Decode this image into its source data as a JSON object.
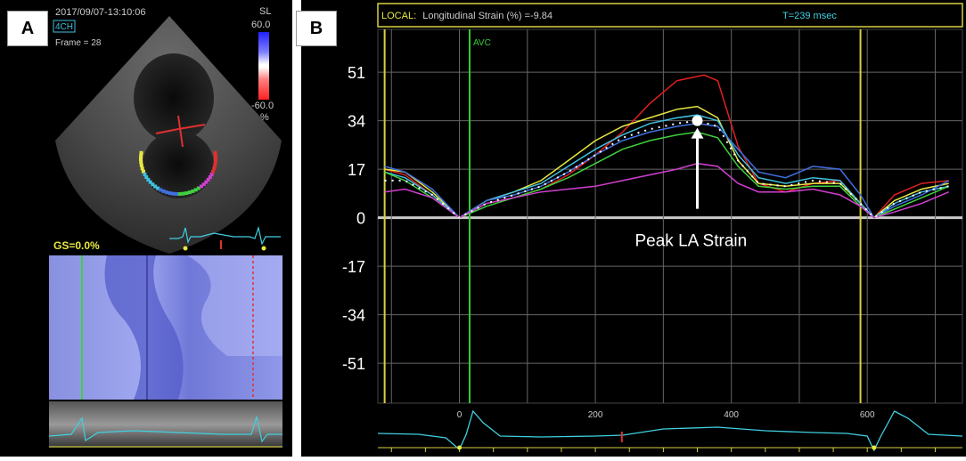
{
  "panel_a": {
    "label": "A",
    "timestamp": "2017/09/07-13:10:06",
    "view": "4CH",
    "frame": "Frame = 28",
    "scale": {
      "title": "SL",
      "max": "60.0",
      "min": "-60.0",
      "unit": "%"
    },
    "gs": "GS=0.0%"
  },
  "panel_b": {
    "label": "B",
    "header_local": "LOCAL:",
    "header_measure": "Longitudinal Strain (%) =-9.84",
    "header_time": "T=239 msec",
    "marker": "AVC",
    "annotation": "Peak LA Strain"
  },
  "colors": {
    "background": "#000000",
    "frame": "#d8d040",
    "grid": "#666666",
    "avc": "#33cc33",
    "ecg": "#40d0e0",
    "annotation": "#ffffff"
  },
  "chart_data": {
    "type": "line",
    "title": "",
    "xlabel": "",
    "ylabel": "",
    "xlim": [
      -120,
      740
    ],
    "ylim": [
      -65,
      66
    ],
    "yticks": [
      51,
      34,
      17,
      0,
      -17,
      -34,
      -51
    ],
    "xticks": [
      0,
      200,
      400,
      600
    ],
    "avc_x": 15,
    "frame_x": [
      -110,
      590
    ],
    "cursor_x": 239,
    "series": [
      {
        "color": "#e02020",
        "dash": false,
        "points": [
          [
            -110,
            17
          ],
          [
            -80,
            15
          ],
          [
            -40,
            8
          ],
          [
            0,
            0
          ],
          [
            40,
            5
          ],
          [
            80,
            7
          ],
          [
            120,
            10
          ],
          [
            160,
            15
          ],
          [
            200,
            22
          ],
          [
            240,
            30
          ],
          [
            280,
            40
          ],
          [
            320,
            48
          ],
          [
            360,
            50
          ],
          [
            380,
            48
          ],
          [
            410,
            25
          ],
          [
            440,
            12
          ],
          [
            480,
            9
          ],
          [
            520,
            12
          ],
          [
            560,
            13
          ],
          [
            590,
            5
          ],
          [
            610,
            0
          ],
          [
            640,
            8
          ],
          [
            680,
            12
          ],
          [
            720,
            13
          ]
        ]
      },
      {
        "color": "#e8e840",
        "dash": false,
        "points": [
          [
            -110,
            17
          ],
          [
            -80,
            16
          ],
          [
            -40,
            9
          ],
          [
            0,
            0
          ],
          [
            40,
            6
          ],
          [
            80,
            9
          ],
          [
            120,
            13
          ],
          [
            160,
            20
          ],
          [
            200,
            27
          ],
          [
            240,
            32
          ],
          [
            280,
            35
          ],
          [
            320,
            38
          ],
          [
            350,
            39
          ],
          [
            380,
            35
          ],
          [
            410,
            20
          ],
          [
            440,
            12
          ],
          [
            480,
            11
          ],
          [
            520,
            12
          ],
          [
            560,
            12
          ],
          [
            590,
            5
          ],
          [
            610,
            0
          ],
          [
            640,
            6
          ],
          [
            680,
            10
          ],
          [
            720,
            12
          ]
        ]
      },
      {
        "color": "#40c0e0",
        "dash": false,
        "points": [
          [
            -110,
            16
          ],
          [
            -80,
            14
          ],
          [
            -40,
            8
          ],
          [
            0,
            0
          ],
          [
            40,
            6
          ],
          [
            80,
            9
          ],
          [
            120,
            12
          ],
          [
            160,
            18
          ],
          [
            200,
            24
          ],
          [
            240,
            29
          ],
          [
            280,
            33
          ],
          [
            320,
            35
          ],
          [
            350,
            36
          ],
          [
            380,
            34
          ],
          [
            410,
            22
          ],
          [
            440,
            14
          ],
          [
            480,
            12
          ],
          [
            520,
            14
          ],
          [
            560,
            13
          ],
          [
            590,
            5
          ],
          [
            610,
            0
          ],
          [
            640,
            5
          ],
          [
            680,
            9
          ],
          [
            720,
            11
          ]
        ]
      },
      {
        "color": "#4070e0",
        "dash": false,
        "points": [
          [
            -110,
            18
          ],
          [
            -80,
            16
          ],
          [
            -40,
            10
          ],
          [
            0,
            0
          ],
          [
            40,
            6
          ],
          [
            80,
            8
          ],
          [
            120,
            11
          ],
          [
            160,
            16
          ],
          [
            200,
            22
          ],
          [
            240,
            27
          ],
          [
            280,
            30
          ],
          [
            320,
            32
          ],
          [
            350,
            33
          ],
          [
            380,
            32
          ],
          [
            410,
            24
          ],
          [
            440,
            16
          ],
          [
            480,
            14
          ],
          [
            520,
            18
          ],
          [
            560,
            17
          ],
          [
            590,
            8
          ],
          [
            610,
            0
          ],
          [
            640,
            4
          ],
          [
            680,
            8
          ],
          [
            720,
            13
          ]
        ]
      },
      {
        "color": "#40d040",
        "dash": false,
        "points": [
          [
            -110,
            16
          ],
          [
            -80,
            13
          ],
          [
            -40,
            7
          ],
          [
            0,
            0
          ],
          [
            40,
            4
          ],
          [
            80,
            7
          ],
          [
            120,
            10
          ],
          [
            160,
            14
          ],
          [
            200,
            19
          ],
          [
            240,
            24
          ],
          [
            280,
            27
          ],
          [
            320,
            29
          ],
          [
            350,
            30
          ],
          [
            380,
            28
          ],
          [
            410,
            18
          ],
          [
            440,
            11
          ],
          [
            480,
            10
          ],
          [
            520,
            11
          ],
          [
            560,
            11
          ],
          [
            590,
            4
          ],
          [
            610,
            0
          ],
          [
            640,
            3
          ],
          [
            680,
            7
          ],
          [
            720,
            11
          ]
        ]
      },
      {
        "color": "#d040d0",
        "dash": false,
        "points": [
          [
            -110,
            9
          ],
          [
            -80,
            10
          ],
          [
            -40,
            7
          ],
          [
            0,
            0
          ],
          [
            40,
            5
          ],
          [
            80,
            7
          ],
          [
            120,
            9
          ],
          [
            160,
            10
          ],
          [
            200,
            11
          ],
          [
            240,
            13
          ],
          [
            280,
            15
          ],
          [
            320,
            17
          ],
          [
            350,
            19
          ],
          [
            380,
            18
          ],
          [
            410,
            12
          ],
          [
            440,
            9
          ],
          [
            480,
            9
          ],
          [
            520,
            10
          ],
          [
            560,
            8
          ],
          [
            590,
            4
          ],
          [
            610,
            0
          ],
          [
            640,
            2
          ],
          [
            680,
            5
          ],
          [
            720,
            9
          ]
        ]
      },
      {
        "color": "#ffffff",
        "dash": true,
        "points": [
          [
            -110,
            13
          ],
          [
            -80,
            13
          ],
          [
            -40,
            8
          ],
          [
            0,
            0
          ],
          [
            40,
            5
          ],
          [
            80,
            8
          ],
          [
            120,
            11
          ],
          [
            160,
            16
          ],
          [
            200,
            22
          ],
          [
            240,
            28
          ],
          [
            280,
            31
          ],
          [
            320,
            33
          ],
          [
            350,
            34
          ],
          [
            380,
            32
          ],
          [
            410,
            20
          ],
          [
            440,
            12
          ],
          [
            480,
            11
          ],
          [
            520,
            13
          ],
          [
            560,
            12
          ],
          [
            590,
            5
          ],
          [
            610,
            0
          ],
          [
            640,
            5
          ],
          [
            680,
            9
          ],
          [
            720,
            11
          ]
        ]
      }
    ],
    "peak": {
      "x": 350,
      "y": 34,
      "label": "Peak LA Strain"
    }
  }
}
